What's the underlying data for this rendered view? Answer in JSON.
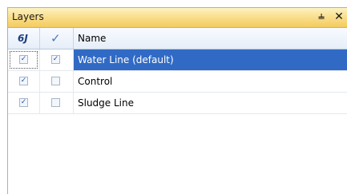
{
  "panel": {
    "title": "Layers",
    "pin_glyph": "⫨",
    "close_glyph": "✕"
  },
  "table": {
    "header": {
      "visibility_icon": "glasses-icon",
      "visibility_glyph": "6J",
      "active_icon": "checkmark-icon",
      "active_glyph": "✓",
      "name_label": "Name"
    },
    "rows": [
      {
        "name": "Water Line (default)",
        "visible": true,
        "active": true,
        "selected": true
      },
      {
        "name": "Control",
        "visible": true,
        "active": false,
        "selected": false
      },
      {
        "name": "Sludge Line",
        "visible": true,
        "active": false,
        "selected": false
      }
    ]
  },
  "colors": {
    "title_bar": "#f9dd8a",
    "selection": "#316ac5"
  }
}
